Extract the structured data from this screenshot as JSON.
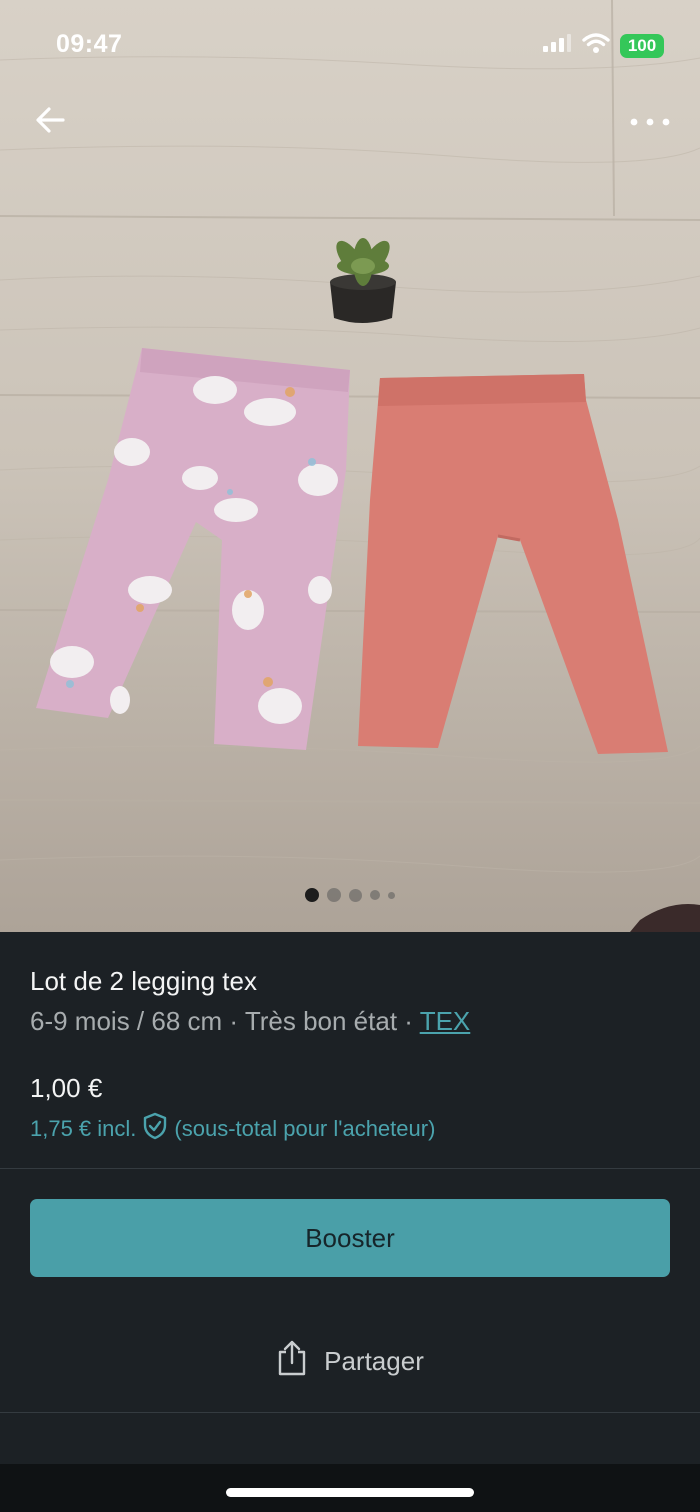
{
  "status_bar": {
    "time": "09:47",
    "battery": "100"
  },
  "listing": {
    "title": "Lot de 2 legging tex",
    "size": "6-9 mois / 68 cm",
    "separator_1": " · ",
    "condition": "Très bon état",
    "separator_2": " · ",
    "brand": "TEX",
    "price": "1,00 €",
    "price_incl": "1,75 € incl.",
    "price_note": "(sous-total pour l'acheteur)"
  },
  "actions": {
    "booster_label": "Booster",
    "share_label": "Partager"
  },
  "gallery": {
    "photo_count": 5,
    "active_index": 0
  },
  "colors": {
    "accent": "#4a9fa8",
    "link": "#4ba3ad",
    "background": "#1c2125",
    "battery": "#34c759"
  },
  "icons": [
    "back-arrow-icon",
    "more-icon",
    "signal-icon",
    "wifi-icon",
    "shield-check-icon",
    "share-icon"
  ]
}
